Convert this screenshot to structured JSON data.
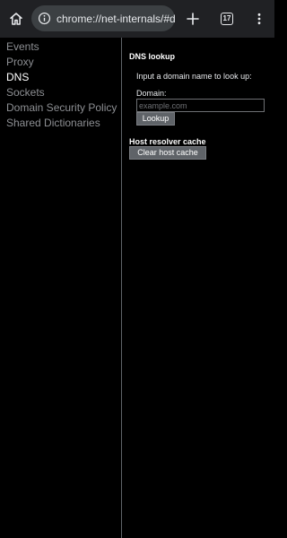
{
  "toolbar": {
    "url": "chrome://net-internals/#dns",
    "tab_count": "17",
    "icons": {
      "home": "home-icon",
      "info": "info-icon",
      "new_tab": "plus-icon",
      "tabs": "tab-switcher-icon",
      "menu": "vertical-dots-icon"
    }
  },
  "sidebar": {
    "items": [
      {
        "label": "Events",
        "active": false
      },
      {
        "label": "Proxy",
        "active": false
      },
      {
        "label": "DNS",
        "active": true
      },
      {
        "label": "Sockets",
        "active": false
      },
      {
        "label": "Domain Security Policy",
        "active": false
      },
      {
        "label": "Shared Dictionaries",
        "active": false
      }
    ]
  },
  "dns_lookup": {
    "title": "DNS lookup",
    "prompt": "Input a domain name to look up:",
    "domain_label": "Domain:",
    "domain_value": "",
    "domain_placeholder": "example.com",
    "lookup_label": "Lookup"
  },
  "host_cache": {
    "title": "Host resolver cache",
    "clear_label": "Clear host cache"
  },
  "colors": {
    "background": "#000000",
    "toolbar": "#202124",
    "omnibox": "#3c4043",
    "nav_inactive": "#8d8f93",
    "nav_active": "#ffffff",
    "button": "#5f6368"
  }
}
